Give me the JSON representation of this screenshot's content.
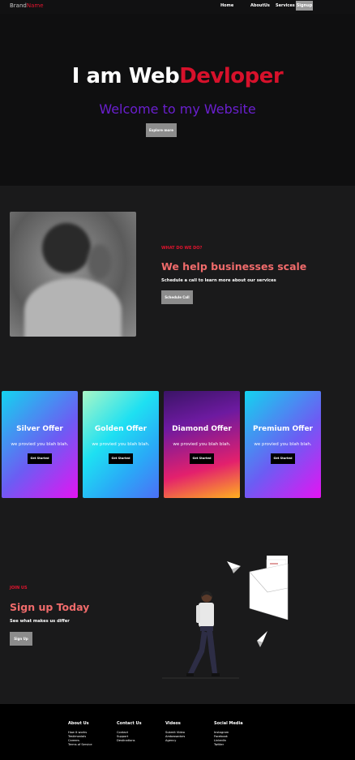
{
  "nav": {
    "brand_part1": "Brand",
    "brand_part2": "Name",
    "links": [
      "Home",
      "AboutUs",
      "Services"
    ],
    "signup": "Signup"
  },
  "hero": {
    "title_part1": "I am Web",
    "title_part2": "Devloper",
    "subtitle": "Welcome to my Website",
    "button": "Explore more"
  },
  "about": {
    "eyebrow": "WHAT DO WE DO?",
    "heading": "We help businesses scale",
    "text": "Schedule a call to learn more about our services",
    "button": "Schedule Call"
  },
  "offers": [
    {
      "title": "Silver Offer",
      "text": "we provied you blah blah.",
      "button": "Get Started"
    },
    {
      "title": "Golden Offer",
      "text": "we provied you blah blah.",
      "button": "Get Started"
    },
    {
      "title": "Diamond Offer",
      "text": "we provied you blah blah.",
      "button": "Get Started"
    },
    {
      "title": "Premium Offer",
      "text": "we provied you blah blah.",
      "button": "Get Started"
    }
  ],
  "join": {
    "eyebrow": "JOIN US",
    "heading": "Sign up Today",
    "text": "See what makes us differ",
    "button": "Sign Up"
  },
  "footer": {
    "columns": [
      {
        "title": "About Us",
        "links": [
          "How it works",
          "Testimonials",
          "Careers",
          "Terms of Service"
        ]
      },
      {
        "title": "Contact Us",
        "links": [
          "Contact",
          "Support",
          "Destinations"
        ]
      },
      {
        "title": "Videos",
        "links": [
          "Submit Video",
          "Ambassadors",
          "Agency"
        ]
      },
      {
        "title": "Social Media",
        "links": [
          "Instagram",
          "Facebook",
          "LinkedIn",
          "Twitter"
        ]
      }
    ]
  },
  "colors": {
    "accent_red": "#e0142e",
    "accent_purple": "#6a1fcf",
    "heading_pink": "#f06b6b",
    "background": "#1a1a1b"
  }
}
